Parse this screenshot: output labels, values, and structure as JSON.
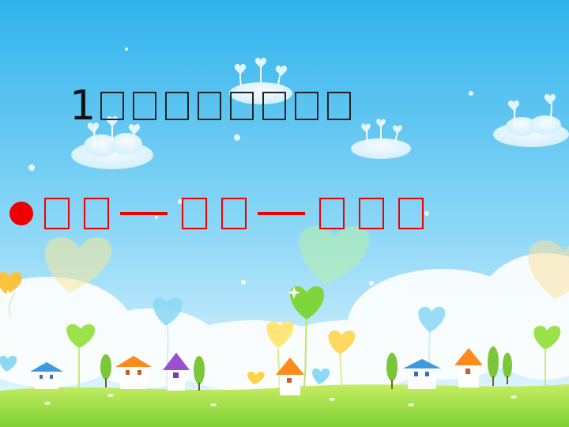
{
  "slide": {
    "title_number": "1",
    "title_placeholder_count": 8,
    "sequence_groups": [
      2,
      2,
      3
    ],
    "colors": {
      "sky_top": "#36b7ee",
      "sky_bottom": "#e8f8ff",
      "grass": "#a8e04a",
      "accent_red": "#ee0000",
      "title_text": "#111111"
    }
  }
}
